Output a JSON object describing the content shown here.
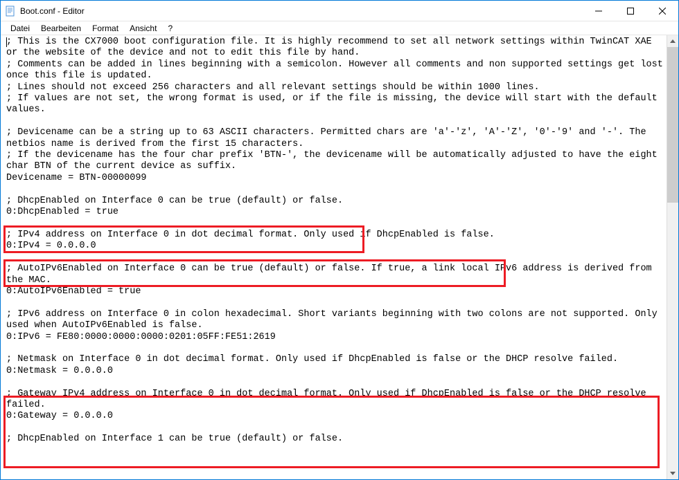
{
  "window": {
    "title": "Boot.conf - Editor"
  },
  "menu": {
    "file": "Datei",
    "edit": "Bearbeiten",
    "format": "Format",
    "view": "Ansicht",
    "help": "?"
  },
  "editor": {
    "line1": "; This is the CX7000 boot configuration file. It is highly recommend to set all network settings within TwinCAT XAE or the website of the device and not to edit this file by hand.",
    "line2": "; Comments can be added in lines beginning with a semicolon. However all comments and non supported settings get lost once this file is updated.",
    "line3": "; Lines should not exceed 256 characters and all relevant settings should be within 1000 lines.",
    "line4": "; If values are not set, the wrong format is used, or if the file is missing, the device will start with the default values.",
    "line5": "",
    "line6": "; Devicename can be a string up to 63 ASCII characters. Permitted chars are 'a'-'z', 'A'-'Z', '0'-'9' and '-'. The netbios name is derived from the first 15 characters.",
    "line7": "; If the devicename has the four char prefix 'BTN-', the devicename will be automatically adjusted to have the eight char BTN of the current device as suffix.",
    "line8": "Devicename = BTN-00000099",
    "line9": "",
    "line10": "; DhcpEnabled on Interface 0 can be true (default) or false.",
    "line11": "0:DhcpEnabled = true",
    "line12": "",
    "line13": "; IPv4 address on Interface 0 in dot decimal format. Only used if DhcpEnabled is false.",
    "line14": "0:IPv4 = 0.0.0.0",
    "line15": "",
    "line16": "; AutoIPv6Enabled on Interface 0 can be true (default) or false. If true, a link local IPv6 address is derived from the MAC.",
    "line17": "0:AutoIPv6Enabled = true",
    "line18": "",
    "line19": "; IPv6 address on Interface 0 in colon hexadecimal. Short variants beginning with two colons are not supported. Only used when AutoIPv6Enabled is false.",
    "line20": "0:IPv6 = FE80:0000:0000:0000:0201:05FF:FE51:2619",
    "line21": "",
    "line22": "; Netmask on Interface 0 in dot decimal format. Only used if DhcpEnabled is false or the DHCP resolve failed.",
    "line23": "0:Netmask = 0.0.0.0",
    "line24": "",
    "line25": "; Gateway IPv4 address on Interface 0 in dot decimal format. Only used if DhcpEnabled is false or the DHCP resolve failed.",
    "line26": "0:Gateway = 0.0.0.0",
    "line27": "",
    "line28": "; DhcpEnabled on Interface 1 can be true (default) or false."
  }
}
